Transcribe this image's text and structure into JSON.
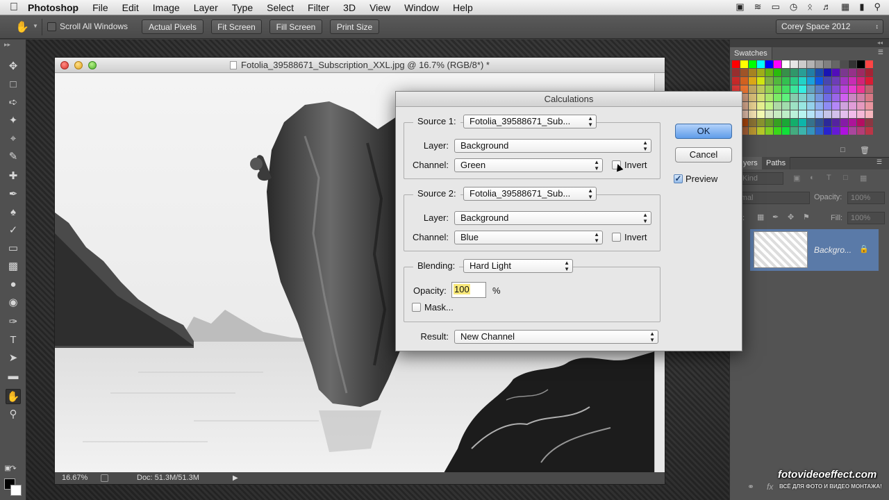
{
  "menubar": {
    "app_name": "Photoshop",
    "items": [
      "File",
      "Edit",
      "Image",
      "Layer",
      "Type",
      "Select",
      "Filter",
      "3D",
      "View",
      "Window",
      "Help"
    ]
  },
  "options_bar": {
    "scroll_all_label": "Scroll All Windows",
    "actual_pixels": "Actual Pixels",
    "fit_screen": "Fit Screen",
    "fill_screen": "Fill Screen",
    "print_size": "Print Size",
    "workspace": "Corey Space 2012"
  },
  "document": {
    "title": "Fotolia_39588671_Subscription_XXL.jpg @ 16.7% (RGB/8*) *",
    "zoom": "16.67%",
    "doc_size": "Doc: 51.3M/51.3M"
  },
  "dialog": {
    "title": "Calculations",
    "source1": {
      "label": "Source 1:",
      "file": "Fotolia_39588671_Sub...",
      "layer_label": "Layer:",
      "layer": "Background",
      "channel_label": "Channel:",
      "channel": "Green",
      "invert_label": "Invert"
    },
    "source2": {
      "label": "Source 2:",
      "file": "Fotolia_39588671_Sub...",
      "layer_label": "Layer:",
      "layer": "Background",
      "channel_label": "Channel:",
      "channel": "Blue",
      "invert_label": "Invert"
    },
    "blending": {
      "label": "Blending:",
      "mode": "Hard Light",
      "opacity_label": "Opacity:",
      "opacity_value": "100",
      "opacity_unit": "%",
      "mask_label": "Mask..."
    },
    "result": {
      "label": "Result:",
      "value": "New Channel"
    },
    "ok": "OK",
    "cancel": "Cancel",
    "preview_label": "Preview",
    "preview_checked": true
  },
  "panels": {
    "swatches_tab": "Swatches",
    "layers_tab": "yers",
    "paths_tab": "Paths",
    "kind_label": "Kind",
    "blend_mode": "rmal",
    "opacity_label": "Opacity:",
    "opacity_value": "100%",
    "fill_label": "Fill:",
    "fill_value": "100%",
    "lock_label": "ck:",
    "layer_name": "Backgro..."
  },
  "watermark": {
    "main": "fotovideoeffect.com",
    "sub": "ВСЁ ДЛЯ ФОТО И ВИДЕО МОНТАЖА!"
  },
  "colors": {
    "dialog_bg": "#e7e7e7",
    "ok_button": "#5f9ce9",
    "layer_selected": "#5a7aa8"
  }
}
